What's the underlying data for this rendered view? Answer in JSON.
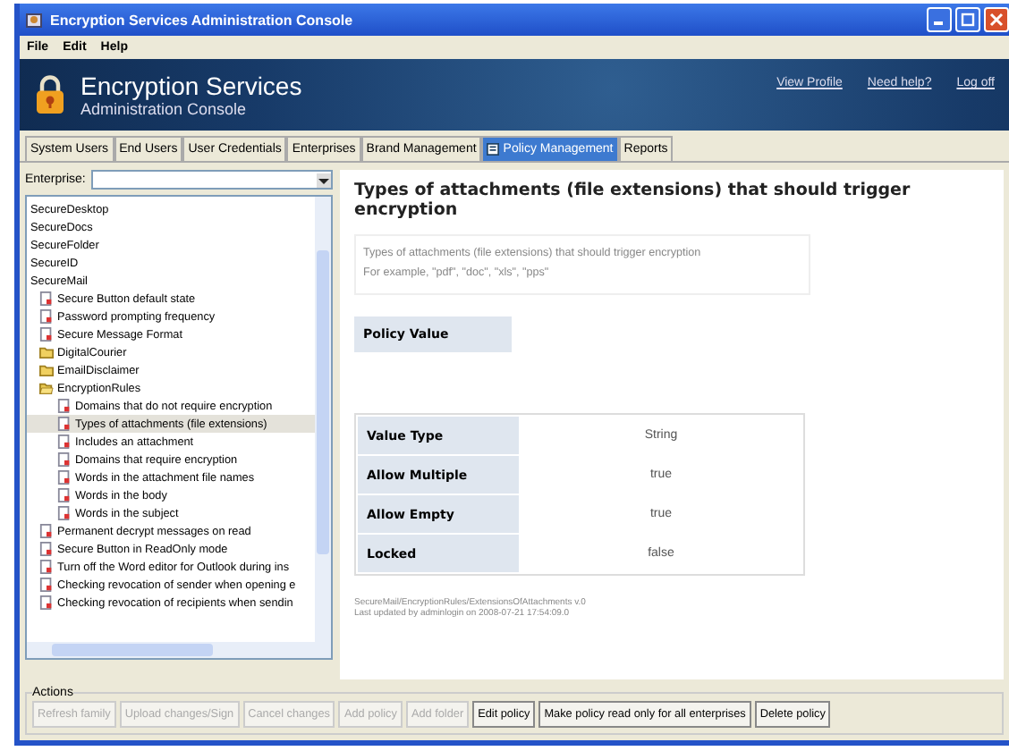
{
  "window": {
    "title": "Encryption Services Administration Console"
  },
  "menu": [
    "File",
    "Edit",
    "Help"
  ],
  "banner": {
    "title": "Encryption Services",
    "subtitle": "Administration Console",
    "links": [
      "View Profile",
      "Need help?",
      "Log off"
    ]
  },
  "tabs": [
    {
      "label": "System Users",
      "selected": false
    },
    {
      "label": "End Users",
      "selected": false
    },
    {
      "label": "User Credentials",
      "selected": false
    },
    {
      "label": "Enterprises",
      "selected": false
    },
    {
      "label": "Brand Management",
      "selected": false
    },
    {
      "label": "Policy Management",
      "selected": true
    },
    {
      "label": "Reports",
      "selected": false
    }
  ],
  "enterprise": {
    "label": "Enterprise:"
  },
  "tree": [
    {
      "kind": "plain",
      "label": "SecureDesktop",
      "selected": false
    },
    {
      "kind": "plain",
      "label": "SecureDocs",
      "selected": false
    },
    {
      "kind": "plain",
      "label": "SecureFolder",
      "selected": false
    },
    {
      "kind": "plain",
      "label": "SecureID",
      "selected": false
    },
    {
      "kind": "plain",
      "label": "SecureMail",
      "selected": false
    },
    {
      "kind": "policy",
      "label": "Secure Button default state",
      "selected": false
    },
    {
      "kind": "policy",
      "label": "Password prompting frequency",
      "selected": false
    },
    {
      "kind": "policy",
      "label": "Secure Message Format",
      "selected": false
    },
    {
      "kind": "folder",
      "label": "DigitalCourier",
      "expanded": false,
      "selected": false
    },
    {
      "kind": "folder",
      "label": "EmailDisclaimer",
      "expanded": false,
      "selected": false
    },
    {
      "kind": "folder",
      "label": "EncryptionRules",
      "expanded": true,
      "selected": false,
      "children": [
        {
          "kind": "policy",
          "label": "Domains that do not require encryption",
          "selected": false
        },
        {
          "kind": "policy",
          "label": "Types of attachments (file extensions)",
          "selected": true
        },
        {
          "kind": "policy",
          "label": "Includes an attachment",
          "selected": false
        },
        {
          "kind": "policy",
          "label": "Domains that require encryption",
          "selected": false
        },
        {
          "kind": "policy",
          "label": "Words in the attachment file names",
          "selected": false
        },
        {
          "kind": "policy",
          "label": "Words in the body",
          "selected": false
        },
        {
          "kind": "policy",
          "label": "Words in the subject",
          "selected": false
        }
      ]
    },
    {
      "kind": "policy",
      "label": "Permanent decrypt messages on read",
      "selected": false
    },
    {
      "kind": "policy",
      "label": "Secure Button in ReadOnly mode",
      "selected": false
    },
    {
      "kind": "policy",
      "label": "Turn off the Word editor for Outlook during ins",
      "selected": false
    },
    {
      "kind": "policy",
      "label": "Checking revocation of sender when opening e",
      "selected": false
    },
    {
      "kind": "policy",
      "label": "Checking revocation of recipients when sendin",
      "selected": false
    }
  ],
  "detail": {
    "title": "Types of attachments (file extensions) that should trigger encryption",
    "description": [
      "Types of attachments (file extensions) that should trigger encryption",
      "For example, \"pdf\", \"doc\", \"xls\", \"pps\""
    ],
    "policy_value_label": "Policy Value",
    "properties": [
      {
        "name": "Value Type",
        "value": "String"
      },
      {
        "name": "Allow Multiple",
        "value": "true"
      },
      {
        "name": "Allow Empty",
        "value": "true"
      },
      {
        "name": "Locked",
        "value": "false"
      }
    ],
    "footer": [
      "SecureMail/EncryptionRules/ExtensionsOfAttachments v.0",
      "Last updated by adminlogin on 2008-07-21 17:54:09.0"
    ]
  },
  "actions": {
    "label": "Actions",
    "buttons": [
      {
        "label": "Refresh family",
        "disabled": true
      },
      {
        "label": "Upload changes/Sign",
        "disabled": true
      },
      {
        "label": "Cancel changes",
        "disabled": true
      },
      {
        "label": "Add policy",
        "disabled": true
      },
      {
        "label": "Add folder",
        "disabled": true
      },
      {
        "label": "Edit policy",
        "disabled": false
      },
      {
        "label": "Make policy read only for all enterprises",
        "disabled": false
      },
      {
        "label": "Delete policy",
        "disabled": false
      }
    ]
  }
}
